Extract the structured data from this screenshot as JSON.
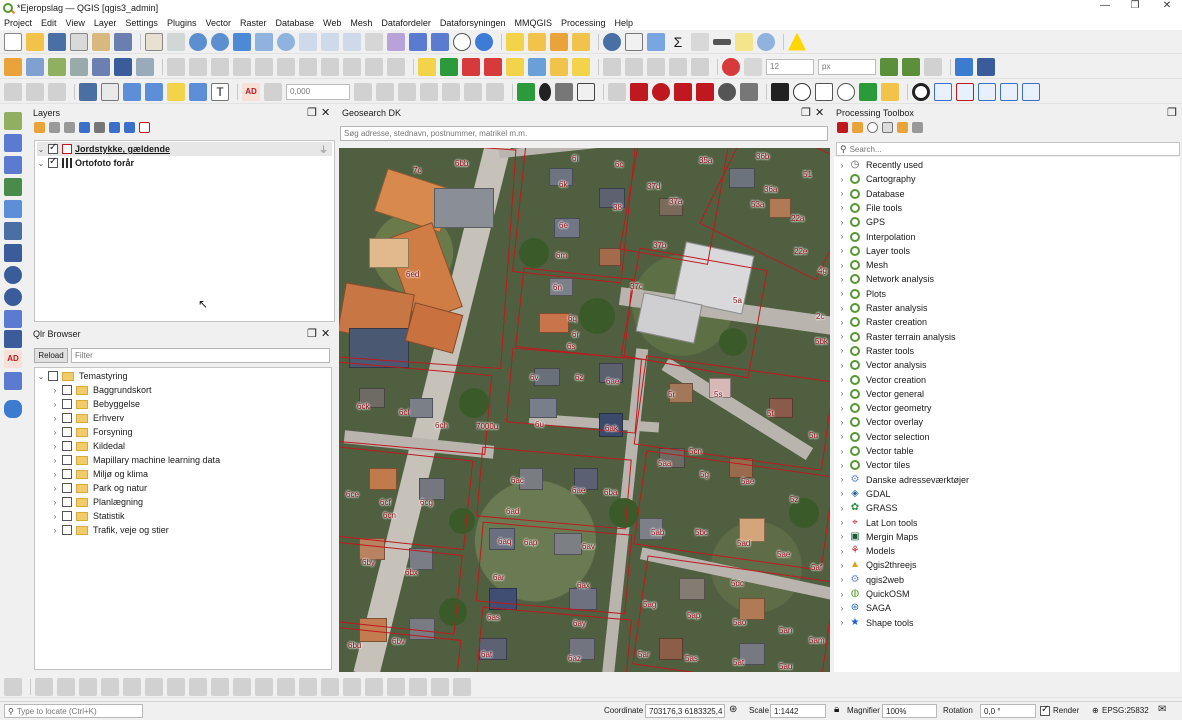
{
  "window": {
    "title": "*Ejeropslag — QGIS [qgis3_admin]",
    "minimize": "—",
    "restore": "❐",
    "close": "✕"
  },
  "menu": [
    "Project",
    "Edit",
    "View",
    "Layer",
    "Settings",
    "Plugins",
    "Vector",
    "Raster",
    "Database",
    "Web",
    "Mesh",
    "Datafordeler",
    "Dataforsyningen",
    "MMQGIS",
    "Processing",
    "Help"
  ],
  "toolbar": {
    "font_size_value": "12",
    "font_unit": "px",
    "rotation_field": "0,000"
  },
  "layers_panel": {
    "title": "Layers",
    "items": [
      {
        "label": "Jordstykke, gældende",
        "checked": true,
        "expanded": true
      },
      {
        "label": "Ortofoto forår",
        "checked": true,
        "expanded": true
      }
    ]
  },
  "browser_panel": {
    "title": "Qlr Browser",
    "reload_label": "Reload",
    "filter_placeholder": "Filter",
    "root": "Temastyring",
    "items": [
      "Baggrundskort",
      "Bebyggelse",
      "Erhverv",
      "Forsyning",
      "Kildedal",
      "Mapillary machine learning data",
      "Miljø og klima",
      "Park og natur",
      "Planlægning",
      "Statistik",
      "Trafik, veje og stier"
    ]
  },
  "geosearch_panel": {
    "title": "Geosearch DK",
    "search_placeholder": "Søg adresse, stednavn, postnummer, matrikel m.m."
  },
  "map": {
    "labels": [
      "7c",
      "6bb",
      "6i",
      "6c",
      "35a",
      "36b",
      "51",
      "6k",
      "37d",
      "36a",
      "53a",
      "22a",
      "38",
      "37a",
      "6e",
      "37b",
      "22e",
      "4g",
      "6m",
      "6n",
      "37c",
      "5a",
      "6ed",
      "6q",
      "6r",
      "6s",
      "2c",
      "5bk",
      "6v",
      "6z",
      "6ae",
      "5r",
      "5s",
      "6ck",
      "6cl",
      "6ch",
      "7000u",
      "6u",
      "6ak",
      "5t",
      "5u",
      "5cn",
      "5aa",
      "5g",
      "5ae",
      "6ac",
      "6ae",
      "6ba",
      "5z",
      "6ce",
      "6cf",
      "6cg",
      "6cn",
      "6ad",
      "5ab",
      "5bc",
      "5ad",
      "6aq",
      "6ap",
      "6av",
      "5ae",
      "6by",
      "6bx",
      "6ar",
      "6ax",
      "5dc",
      "5af",
      "6as",
      "5ag",
      "5ap",
      "5ao",
      "5an",
      "5am",
      "6ay",
      "6at",
      "6bu",
      "6bv",
      "6az",
      "5ar",
      "5as",
      "5at",
      "5au"
    ]
  },
  "processing_panel": {
    "title": "Processing Toolbox",
    "search_placeholder": "Search...",
    "items": [
      {
        "label": "Recently used",
        "icon": "clock-icon"
      },
      {
        "label": "Cartography",
        "icon": "qgis-icon"
      },
      {
        "label": "Database",
        "icon": "qgis-icon"
      },
      {
        "label": "File tools",
        "icon": "qgis-icon"
      },
      {
        "label": "GPS",
        "icon": "qgis-icon"
      },
      {
        "label": "Interpolation",
        "icon": "qgis-icon"
      },
      {
        "label": "Layer tools",
        "icon": "qgis-icon"
      },
      {
        "label": "Mesh",
        "icon": "qgis-icon"
      },
      {
        "label": "Network analysis",
        "icon": "qgis-icon"
      },
      {
        "label": "Plots",
        "icon": "qgis-icon"
      },
      {
        "label": "Raster analysis",
        "icon": "qgis-icon"
      },
      {
        "label": "Raster creation",
        "icon": "qgis-icon"
      },
      {
        "label": "Raster terrain analysis",
        "icon": "qgis-icon"
      },
      {
        "label": "Raster tools",
        "icon": "qgis-icon"
      },
      {
        "label": "Vector analysis",
        "icon": "qgis-icon"
      },
      {
        "label": "Vector creation",
        "icon": "qgis-icon"
      },
      {
        "label": "Vector general",
        "icon": "qgis-icon"
      },
      {
        "label": "Vector geometry",
        "icon": "qgis-icon"
      },
      {
        "label": "Vector overlay",
        "icon": "qgis-icon"
      },
      {
        "label": "Vector selection",
        "icon": "qgis-icon"
      },
      {
        "label": "Vector table",
        "icon": "qgis-icon"
      },
      {
        "label": "Vector tiles",
        "icon": "qgis-icon"
      },
      {
        "label": "Danske adresseværktøjer",
        "icon": "gear-icon"
      },
      {
        "label": "GDAL",
        "icon": "gdal-icon"
      },
      {
        "label": "GRASS",
        "icon": "grass-icon"
      },
      {
        "label": "Lat Lon tools",
        "icon": "latlon-icon"
      },
      {
        "label": "Mergin Maps",
        "icon": "mergin-icon"
      },
      {
        "label": "Models",
        "icon": "models-icon"
      },
      {
        "label": "Qgis2threejs",
        "icon": "threejs-icon"
      },
      {
        "label": "qgis2web",
        "icon": "gear-icon"
      },
      {
        "label": "QuickOSM",
        "icon": "quickosm-icon"
      },
      {
        "label": "SAGA",
        "icon": "saga-icon"
      },
      {
        "label": "Shape tools",
        "icon": "star-icon"
      }
    ]
  },
  "statusbar": {
    "locate_placeholder": "Type to locate (Ctrl+K)",
    "coordinate_label": "Coordinate",
    "coordinate_value": "703176,3 6183325,4",
    "scale_label": "Scale",
    "scale_value": "1:1442",
    "magnifier_label": "Magnifier",
    "magnifier_value": "100%",
    "rotation_label": "Rotation",
    "rotation_value": "0,0 °",
    "render_label": "Render",
    "crs_label": "EPSG:25832"
  }
}
